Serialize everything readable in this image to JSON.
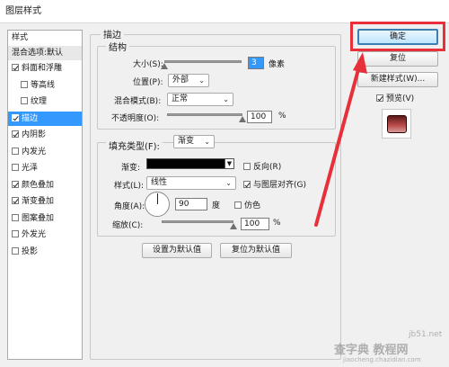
{
  "window": {
    "title": "图层样式"
  },
  "styles_panel": {
    "header": "样式",
    "blend_default": "混合选项:默认",
    "items": [
      {
        "label": "斜面和浮雕",
        "checked": true,
        "indent": false,
        "has_checkbox": true
      },
      {
        "label": "等高线",
        "checked": false,
        "indent": true,
        "has_checkbox": true
      },
      {
        "label": "纹理",
        "checked": false,
        "indent": true,
        "has_checkbox": true
      },
      {
        "label": "描边",
        "checked": true,
        "indent": false,
        "has_checkbox": true,
        "selected": true
      },
      {
        "label": "内阴影",
        "checked": true,
        "indent": false,
        "has_checkbox": true
      },
      {
        "label": "内发光",
        "checked": false,
        "indent": false,
        "has_checkbox": true
      },
      {
        "label": "光泽",
        "checked": false,
        "indent": false,
        "has_checkbox": true
      },
      {
        "label": "颜色叠加",
        "checked": true,
        "indent": false,
        "has_checkbox": true
      },
      {
        "label": "渐变叠加",
        "checked": true,
        "indent": false,
        "has_checkbox": true
      },
      {
        "label": "图案叠加",
        "checked": false,
        "indent": false,
        "has_checkbox": true
      },
      {
        "label": "外发光",
        "checked": false,
        "indent": false,
        "has_checkbox": true
      },
      {
        "label": "投影",
        "checked": false,
        "indent": false,
        "has_checkbox": true
      }
    ]
  },
  "stroke": {
    "group_title": "描边",
    "structure_title": "结构",
    "size_label": "大小(S):",
    "size_value": "3",
    "size_unit": "像素",
    "position_label": "位置(P):",
    "position_value": "外部",
    "blend_label": "混合模式(B):",
    "blend_value": "正常",
    "opacity_label": "不透明度(O):",
    "opacity_value": "100",
    "opacity_unit": "%",
    "opacity_level": 1.0,
    "size_level": 0.0,
    "fill_type_label": "填充类型(F):",
    "fill_type_value": "渐变",
    "gradient_label": "渐变:",
    "reverse_label": "反向(R)",
    "reverse_checked": false,
    "style_label": "样式(L):",
    "style_value": "线性",
    "align_label": "与图层对齐(G)",
    "align_checked": true,
    "angle_label": "角度(A):",
    "angle_value": "90",
    "angle_unit": "度",
    "dither_label": "仿色",
    "dither_checked": false,
    "scale_label": "缩放(C):",
    "scale_value": "100",
    "scale_unit": "%",
    "scale_level": 1.0,
    "set_default_label": "设置为默认值",
    "reset_default_label": "复位为默认值"
  },
  "buttons": {
    "ok": "确定",
    "reset": "复位",
    "new_style": "新建样式(W)...",
    "preview": "预览(V)",
    "preview_checked": true
  },
  "watermarks": {
    "site1": "jb51.net",
    "site2": "查字典 教程网",
    "site3": "jiaocheng.chazidian.com"
  },
  "colors": {
    "highlight": "#e8303a",
    "selection": "#3399ff",
    "preview_red": "#b84848"
  }
}
